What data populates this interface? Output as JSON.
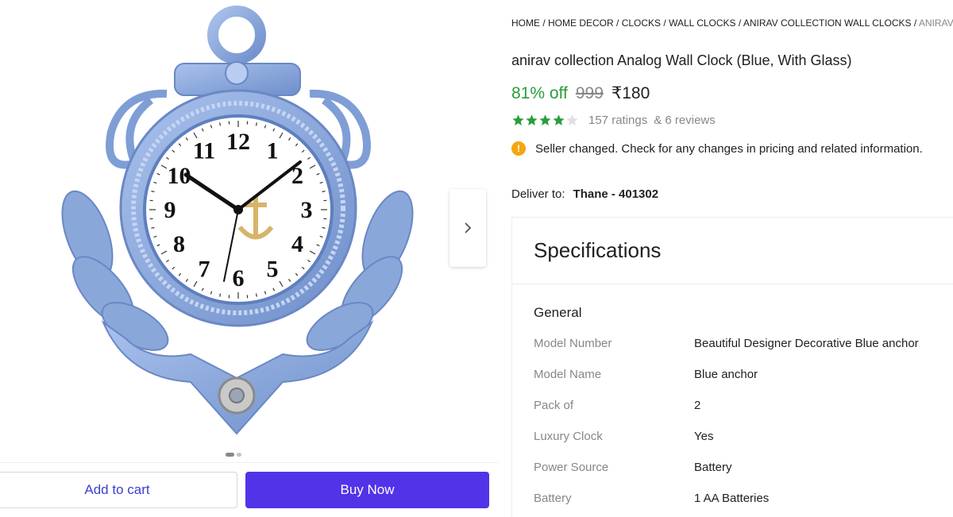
{
  "gallery": {
    "image_alt": "anirav collection Analog Wall Clock (Blue, With Glass)",
    "clock_numbers": [
      "12",
      "1",
      "2",
      "3",
      "4",
      "5",
      "6",
      "7",
      "8",
      "9",
      "10",
      "11"
    ],
    "slide_count": 2,
    "active_slide": 1,
    "next_icon": "chevron-right-icon"
  },
  "actions": {
    "add_to_cart": "Add to cart",
    "buy_now": "Buy Now"
  },
  "breadcrumb": {
    "items": [
      "HOME",
      "HOME DECOR",
      "CLOCKS",
      "WALL CLOCKS",
      "ANIRAV COLLECTION WALL CLOCKS"
    ],
    "current": "ANIRAV COL"
  },
  "product": {
    "title": "anirav collection Analog Wall Clock (Blue, With Glass)",
    "discount": "81% off",
    "mrp": "999",
    "price": "₹180",
    "stars_filled": 4,
    "stars_total": 5,
    "ratings": "157 ratings",
    "reviews": "& 6 reviews",
    "notice": "Seller changed. Check for any changes in pricing and related information.",
    "notice_icon": "info-icon"
  },
  "delivery": {
    "label": "Deliver to:",
    "location": "Thane - 401302"
  },
  "specifications": {
    "title": "Specifications",
    "group": "General",
    "rows": [
      {
        "key": "Model Number",
        "value": "Beautiful Designer Decorative Blue anchor"
      },
      {
        "key": "Model Name",
        "value": "Blue anchor"
      },
      {
        "key": "Pack of",
        "value": "2"
      },
      {
        "key": "Luxury Clock",
        "value": "Yes"
      },
      {
        "key": "Power Source",
        "value": "Battery"
      },
      {
        "key": "Battery",
        "value": "1 AA Batteries"
      }
    ]
  },
  "colors": {
    "discount_green": "#2a9d3c",
    "star_green": "#2a9d3c",
    "buy_button": "#5233e8",
    "cart_text": "#3c3fd0",
    "clock_blue": "#8aa7da",
    "info_orange": "#f3a712"
  }
}
